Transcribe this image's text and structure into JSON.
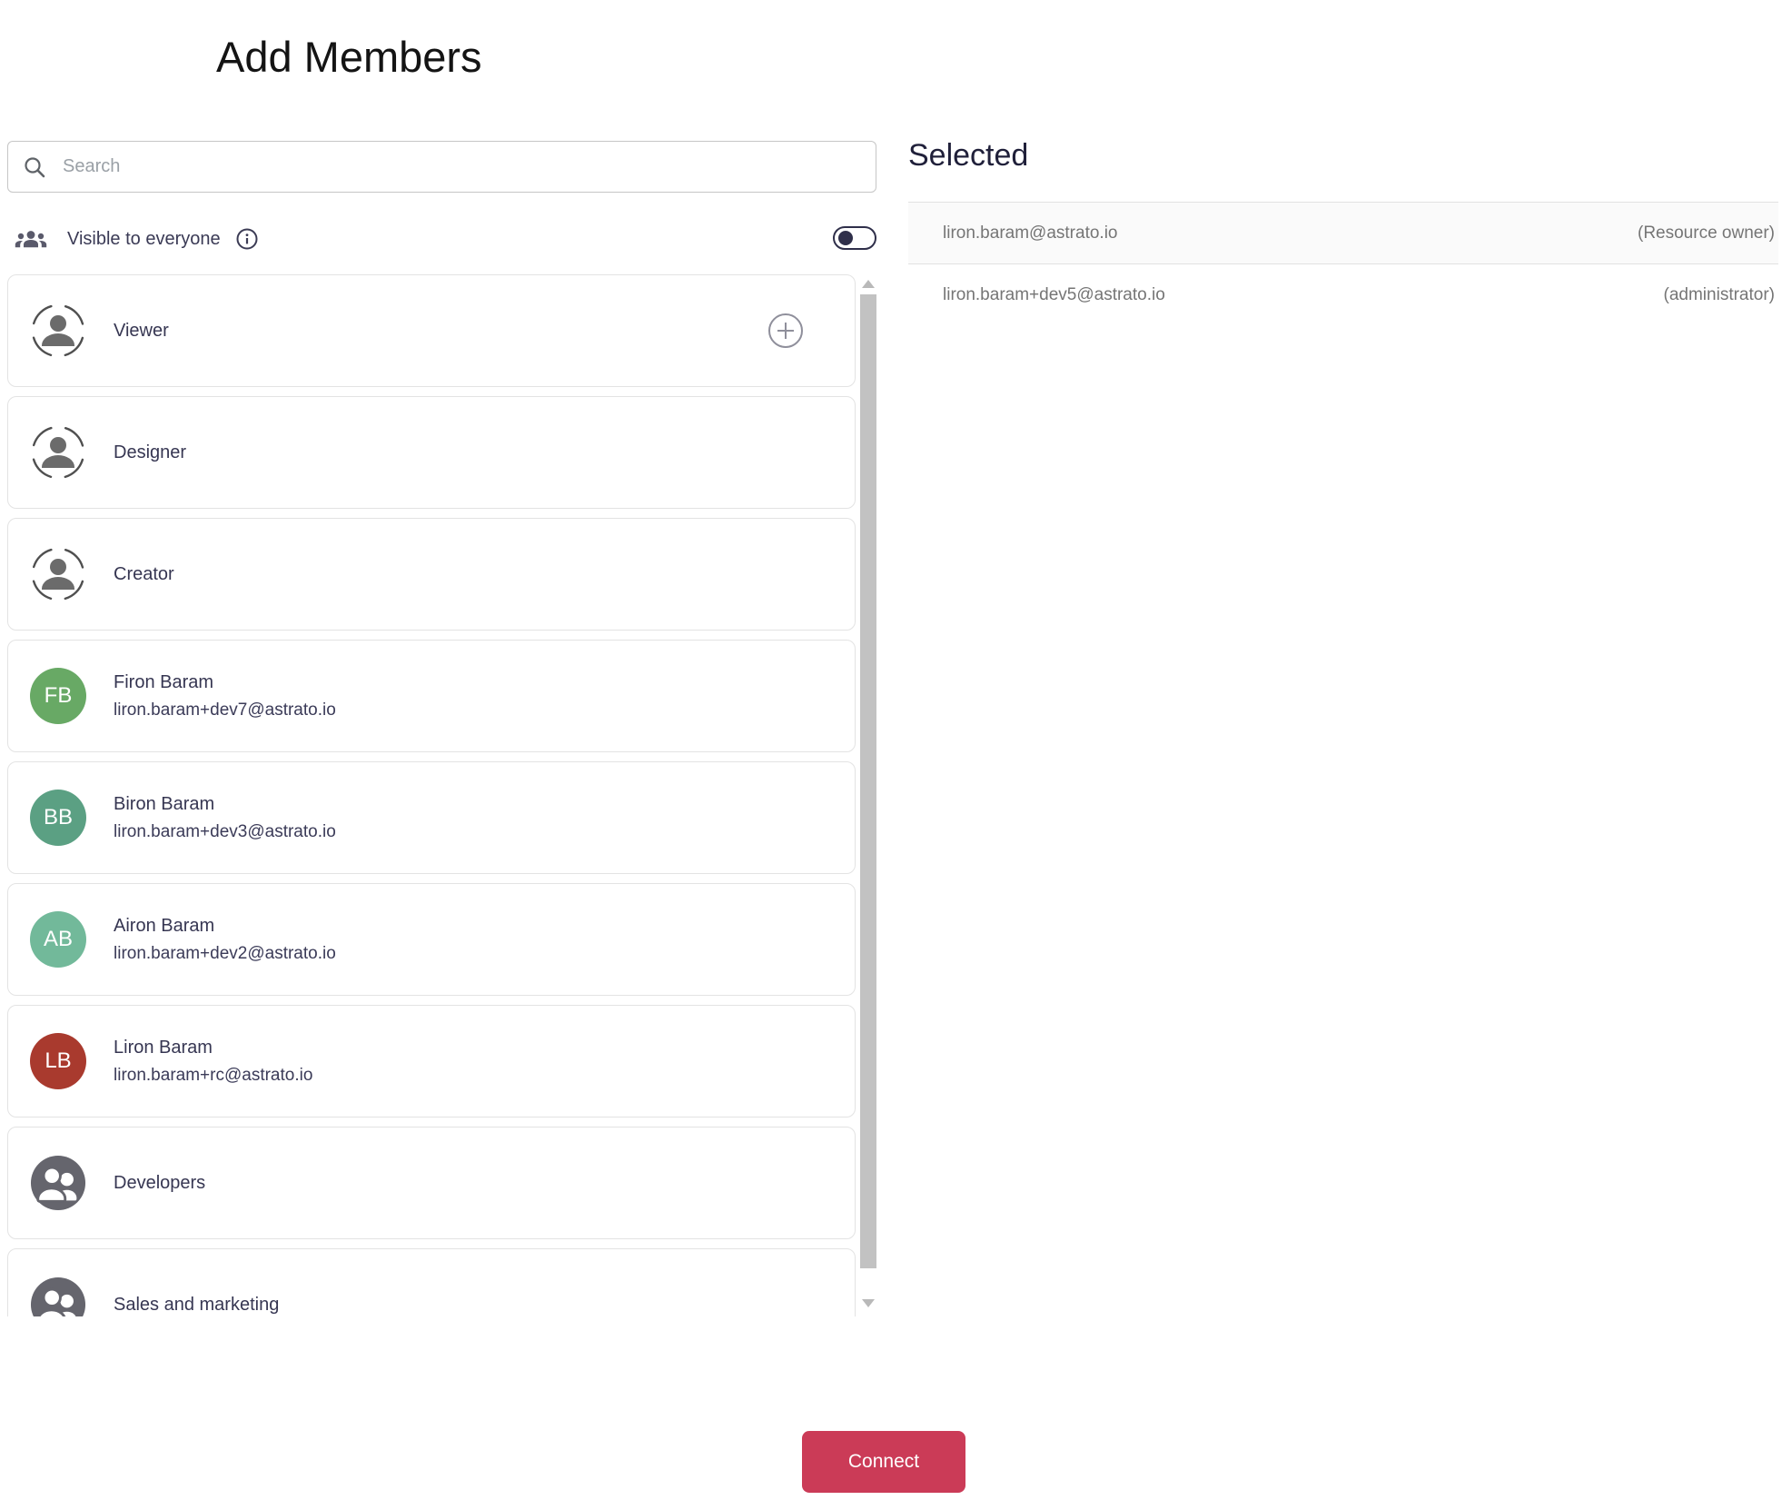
{
  "window": {
    "title": "Add Members"
  },
  "search": {
    "placeholder": "Search"
  },
  "visibility": {
    "label": "Visible to everyone",
    "toggle_state": "off"
  },
  "member_list": {
    "items": [
      {
        "type": "role",
        "label": "Viewer",
        "show_add_button": true
      },
      {
        "type": "role",
        "label": "Designer",
        "show_add_button": false
      },
      {
        "type": "role",
        "label": "Creator",
        "show_add_button": false
      },
      {
        "type": "user",
        "name": "Firon Baram",
        "email": "liron.baram+dev7@astrato.io",
        "initials": "FB",
        "avatar_color": "#68a965"
      },
      {
        "type": "user",
        "name": "Biron Baram",
        "email": "liron.baram+dev3@astrato.io",
        "initials": "BB",
        "avatar_color": "#5ba083"
      },
      {
        "type": "user",
        "name": "Airon Baram",
        "email": "liron.baram+dev2@astrato.io",
        "initials": "AB",
        "avatar_color": "#72b99a"
      },
      {
        "type": "user",
        "name": "Liron Baram",
        "email": "liron.baram+rc@astrato.io",
        "initials": "LB",
        "avatar_color": "#a93a2e"
      },
      {
        "type": "group",
        "label": "Developers"
      },
      {
        "type": "group",
        "label": "Sales and marketing"
      }
    ]
  },
  "selected_panel": {
    "title": "Selected",
    "rows": [
      {
        "email": "liron.baram@astrato.io",
        "role": "(Resource owner)"
      },
      {
        "email": "liron.baram+dev5@astrato.io",
        "role": "(administrator)"
      }
    ]
  },
  "actions": {
    "connect_label": "Connect"
  },
  "colors": {
    "accent_red": "#cb3b57",
    "toggle": "#2f2f4a",
    "group_icon_bg": "#65656d",
    "scrollbar_thumb": "#c2c2c2",
    "card_border": "#e3e3e3"
  }
}
